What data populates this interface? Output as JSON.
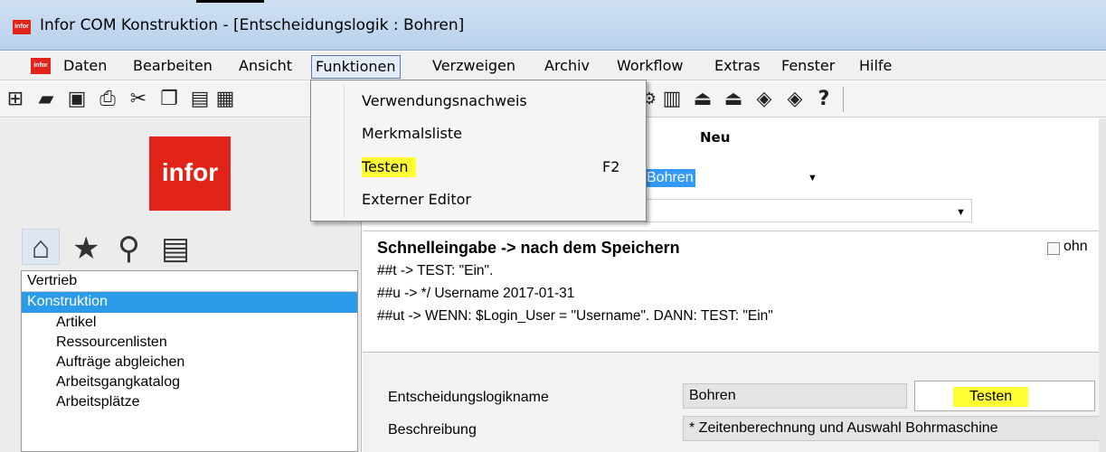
{
  "window": {
    "title": "Infor COM Konstruktion - [Entscheidungslogik : Bohren]",
    "logo_text": "infor"
  },
  "menubar": {
    "items": [
      "Daten",
      "Bearbeiten",
      "Ansicht",
      "Funktionen",
      "Verzweigen",
      "Archiv",
      "Workflow",
      "Extras",
      "Fenster",
      "Hilfe"
    ],
    "active": "Funktionen"
  },
  "dropdown": {
    "items": [
      {
        "label": "Verwendungsnachweis",
        "shortcut": ""
      },
      {
        "label": "Merkmalsliste",
        "shortcut": ""
      },
      {
        "label": "Testen",
        "shortcut": "F2"
      },
      {
        "label": "Externer Editor",
        "shortcut": ""
      }
    ]
  },
  "toolbar": {
    "icons": [
      "new-icon",
      "open-icon",
      "save-icon",
      "print-icon",
      "cut-icon",
      "copy-icon",
      "paste-icon",
      "clipboard-icon",
      "barcode-icon",
      "import-icon",
      "export-icon",
      "diamond-icon",
      "zip-icon",
      "help-icon"
    ]
  },
  "sidebar": {
    "logo": "infor",
    "items": [
      {
        "label": "Vertrieb",
        "level": 0
      },
      {
        "label": "Konstruktion",
        "level": 0,
        "selected": true
      },
      {
        "label": "Artikel",
        "level": 1
      },
      {
        "label": "Ressourcenlisten",
        "level": 1
      },
      {
        "label": "Aufträge abgleichen",
        "level": 1
      },
      {
        "label": "Arbeitsgangkatalog",
        "level": 1
      },
      {
        "label": "Arbeitsplätze",
        "level": 1
      }
    ]
  },
  "main": {
    "neu_label": "Neu",
    "combo1_value": "Bohren",
    "combo2_value": "",
    "schnelleingabe": {
      "title": "Schnelleingabe -> nach dem Speichern",
      "lines": [
        "##t   -> TEST: \"Ein\".",
        "##u   -> */ Username 2017-01-31",
        "##ut -> WENN: $Login_User = \"Username\". DANN: TEST: \"Ein\""
      ],
      "checkbox_label": "ohn"
    },
    "form": {
      "name_label": "Entscheidungslogikname",
      "name_value": "Bohren",
      "desc_label": "Beschreibung",
      "desc_value": "* Zeitenberechnung und Auswahl Bohrmaschine",
      "test_button": "Testen"
    }
  },
  "colors": {
    "brand_red": "#e2231a",
    "selection_blue": "#2b9ae8",
    "highlight_yellow": "#ffff33"
  }
}
